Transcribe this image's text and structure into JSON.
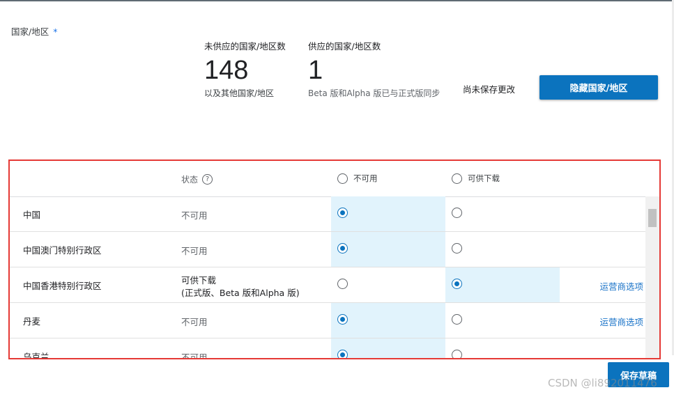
{
  "field": {
    "label": "国家/地区",
    "required_mark": "*"
  },
  "stats": {
    "unavailable": {
      "caption": "未供应的国家/地区数",
      "count": "148",
      "note": "以及其他国家/地区"
    },
    "available": {
      "caption": "供应的国家/地区数",
      "count": "1",
      "note": "Beta 版和Alpha 版已与正式版同步"
    }
  },
  "unsaved_text": "尚未保存更改",
  "hide_button": "隐藏国家/地区",
  "table": {
    "header": {
      "status_label": "状态",
      "help_icon": "?",
      "option_unavailable": "不可用",
      "option_available": "可供下载"
    },
    "rows": [
      {
        "name": "中国",
        "status_line1": "不可用",
        "status_line2": "",
        "selected": "unavailable",
        "link": ""
      },
      {
        "name": "中国澳门特别行政区",
        "status_line1": "不可用",
        "status_line2": "",
        "selected": "unavailable",
        "link": ""
      },
      {
        "name": "中国香港特别行政区",
        "status_line1": "可供下载",
        "status_line2": "(正式版、Beta 版和Alpha 版)",
        "selected": "available",
        "link": "运营商选项"
      },
      {
        "name": "丹麦",
        "status_line1": "不可用",
        "status_line2": "",
        "selected": "unavailable",
        "link": "运营商选项"
      },
      {
        "name": "乌克兰",
        "status_line1": "不可用",
        "status_line2": "",
        "selected": "unavailable",
        "link": ""
      }
    ]
  },
  "save_draft_button": "保存草稿",
  "watermark": "CSDN @li892011476",
  "colors": {
    "accent": "#0b73be",
    "selected_cell": "#e1f3fc",
    "highlight_border": "#e53935"
  }
}
